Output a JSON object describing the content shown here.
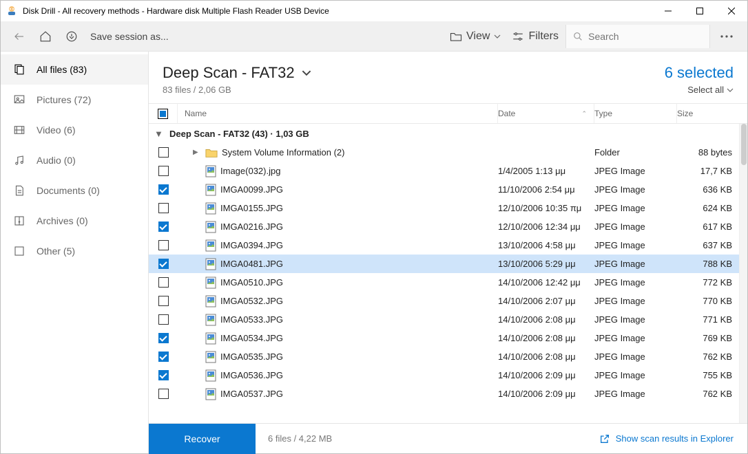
{
  "titlebar": {
    "title": "Disk Drill - All recovery methods - Hardware disk Multiple Flash Reader USB Device"
  },
  "toolbar": {
    "save_session": "Save session as...",
    "view_label": "View",
    "filters_label": "Filters",
    "search_placeholder": "Search"
  },
  "sidebar": {
    "items": [
      {
        "label": "All files (83)"
      },
      {
        "label": "Pictures (72)"
      },
      {
        "label": "Video (6)"
      },
      {
        "label": "Audio (0)"
      },
      {
        "label": "Documents (0)"
      },
      {
        "label": "Archives (0)"
      },
      {
        "label": "Other (5)"
      }
    ]
  },
  "header": {
    "title": "Deep Scan - FAT32",
    "subtitle": "83 files / 2,06 GB",
    "selected_text": "6 selected",
    "select_all": "Select all"
  },
  "columns": {
    "name": "Name",
    "date": "Date",
    "type": "Type",
    "size": "Size"
  },
  "group": {
    "label": "Deep Scan - FAT32 (43) · 1,03 GB"
  },
  "rows": [
    {
      "checked": false,
      "is_folder": true,
      "name": "System Volume Information (2)",
      "date": "",
      "type": "Folder",
      "size": "88 bytes",
      "selected": false,
      "expandable": true
    },
    {
      "checked": false,
      "is_folder": false,
      "name": "Image(032).jpg",
      "date": "1/4/2005 1:13 μμ",
      "type": "JPEG Image",
      "size": "17,7 KB",
      "selected": false
    },
    {
      "checked": true,
      "is_folder": false,
      "name": "IMGA0099.JPG",
      "date": "11/10/2006 2:54 μμ",
      "type": "JPEG Image",
      "size": "636 KB",
      "selected": false
    },
    {
      "checked": false,
      "is_folder": false,
      "name": "IMGA0155.JPG",
      "date": "12/10/2006 10:35 πμ",
      "type": "JPEG Image",
      "size": "624 KB",
      "selected": false
    },
    {
      "checked": true,
      "is_folder": false,
      "name": "IMGA0216.JPG",
      "date": "12/10/2006 12:34 μμ",
      "type": "JPEG Image",
      "size": "617 KB",
      "selected": false
    },
    {
      "checked": false,
      "is_folder": false,
      "name": "IMGA0394.JPG",
      "date": "13/10/2006 4:58 μμ",
      "type": "JPEG Image",
      "size": "637 KB",
      "selected": false
    },
    {
      "checked": true,
      "is_folder": false,
      "name": "IMGA0481.JPG",
      "date": "13/10/2006 5:29 μμ",
      "type": "JPEG Image",
      "size": "788 KB",
      "selected": true
    },
    {
      "checked": false,
      "is_folder": false,
      "name": "IMGA0510.JPG",
      "date": "14/10/2006 12:42 μμ",
      "type": "JPEG Image",
      "size": "772 KB",
      "selected": false
    },
    {
      "checked": false,
      "is_folder": false,
      "name": "IMGA0532.JPG",
      "date": "14/10/2006 2:07 μμ",
      "type": "JPEG Image",
      "size": "770 KB",
      "selected": false
    },
    {
      "checked": false,
      "is_folder": false,
      "name": "IMGA0533.JPG",
      "date": "14/10/2006 2:08 μμ",
      "type": "JPEG Image",
      "size": "771 KB",
      "selected": false
    },
    {
      "checked": true,
      "is_folder": false,
      "name": "IMGA0534.JPG",
      "date": "14/10/2006 2:08 μμ",
      "type": "JPEG Image",
      "size": "769 KB",
      "selected": false
    },
    {
      "checked": true,
      "is_folder": false,
      "name": "IMGA0535.JPG",
      "date": "14/10/2006 2:08 μμ",
      "type": "JPEG Image",
      "size": "762 KB",
      "selected": false
    },
    {
      "checked": true,
      "is_folder": false,
      "name": "IMGA0536.JPG",
      "date": "14/10/2006 2:09 μμ",
      "type": "JPEG Image",
      "size": "755 KB",
      "selected": false
    },
    {
      "checked": false,
      "is_folder": false,
      "name": "IMGA0537.JPG",
      "date": "14/10/2006 2:09 μμ",
      "type": "JPEG Image",
      "size": "762 KB",
      "selected": false
    }
  ],
  "footer": {
    "recover": "Recover",
    "summary": "6 files / 4,22 MB",
    "explorer_link": "Show scan results in Explorer"
  }
}
